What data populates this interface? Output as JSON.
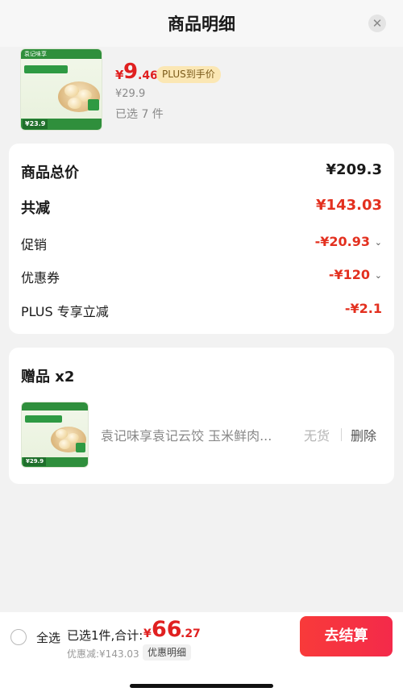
{
  "header": {
    "title": "商品明细",
    "close_icon": "close-icon"
  },
  "product": {
    "thumb": {
      "brand": "袁记味享",
      "price_tag": "¥23.9"
    },
    "price_yen": "¥",
    "price_int": "9",
    "price_dec": ".46",
    "plus_badge": "PLUS到手价",
    "orig_price": "¥29.9",
    "selected": "已选 7 件"
  },
  "summary": {
    "rows": [
      {
        "label": "商品总价",
        "value": "¥209.3"
      },
      {
        "label": "共减",
        "value": "¥143.03"
      },
      {
        "label": "促销",
        "value": "-¥20.93"
      },
      {
        "label": "优惠券",
        "value": "-¥120"
      },
      {
        "label": "PLUS 专享立减",
        "value": "-¥2.1"
      }
    ]
  },
  "gift": {
    "title": "赠品 x2",
    "thumb": {
      "price_tag": "¥29.9"
    },
    "name": "袁记味享袁记云饺 玉米鲜肉...",
    "stock": "无货",
    "delete": "删除"
  },
  "footer": {
    "select_all": "全选",
    "selected_total_label": "已选1件,合计:",
    "total_yen": "¥",
    "total_int": "66",
    "total_dec": ".27",
    "discount": "优惠减:¥143.03",
    "detail_btn": "优惠明细",
    "checkout": "去结算"
  },
  "colors": {
    "accent_red": "#e3301f",
    "plus_gold": "#fbe7b4",
    "brand_green": "#2f8f3c"
  }
}
